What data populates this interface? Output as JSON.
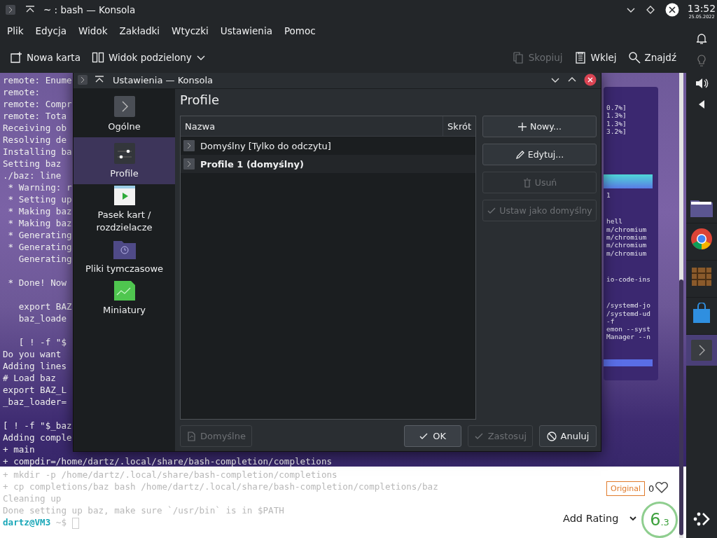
{
  "window": {
    "title": "~ : bash — Konsola"
  },
  "clock": {
    "time": "13:52",
    "date": "25.05.2022"
  },
  "menu": [
    "Plik",
    "Edycja",
    "Widok",
    "Zakładki",
    "Wtyczki",
    "Ustawienia",
    "Pomoc"
  ],
  "toolbar": [
    {
      "label": "Nowa karta",
      "kind": "new-tab",
      "disabled": false
    },
    {
      "label": "Widok podzielony",
      "kind": "split",
      "disabled": false
    },
    {
      "label": "Skopiuj",
      "kind": "copy",
      "disabled": true
    },
    {
      "label": "Wklej",
      "kind": "paste",
      "disabled": false
    },
    {
      "label": "Znajdź",
      "kind": "find",
      "disabled": false
    }
  ],
  "terminal": {
    "blocks": [
      [
        "remote: Enume",
        "remote:",
        "remote: Compr",
        "remote: Tota",
        "Receiving ob",
        "Resolving de",
        "Installing ba",
        "Setting baz",
        "./baz: line",
        " * Warning: r",
        " * Setting up",
        " * Making baz",
        " * Making baz",
        " * Generating",
        " * Generating",
        "   Generating"
      ],
      [
        " * Done! Now"
      ],
      [
        "   export BAZ",
        "   baz_loade"
      ],
      [
        "   [ ! -f \"$",
        "Do you want",
        "Adding lines",
        "# Load baz",
        "export BAZ_L",
        "_baz_loader="
      ],
      [
        "[ ! -f \"$_baz",
        "Adding comple",
        "+ main",
        "+ compdir=/home/dartz/.local/share/bash-completion/completions"
      ]
    ],
    "faded_lines": [
      "+ mkdir -p /home/dartz/.local/share/bash-completion/completions",
      "+ cp completions/baz bash /home/dartz/.local/share/bash-completion/completions/baz",
      "Cleaning up",
      "Done setting up baz, make sure `/usr/bin` is in $PATH"
    ],
    "prompt": {
      "user": "dartz@VM3",
      "path": "~$"
    }
  },
  "monitor": {
    "groups": [
      [
        "0.7%]",
        "1.3%]",
        "1.3%]",
        "3.2%]"
      ],
      [
        "1"
      ],
      [
        "hell",
        "m/chromium",
        "m/chromium",
        "m/chromium",
        "m/chromium"
      ],
      [
        "io-code-ins"
      ],
      [
        "/systemd-jo",
        "/systemd-ud",
        "-f",
        "emon --syst",
        "Manager --n"
      ]
    ]
  },
  "dialog": {
    "title": "Ustawienia — Konsola",
    "sidebar": [
      {
        "label": "Ogólne",
        "kind": "general",
        "selected": false
      },
      {
        "label": "Profile",
        "kind": "profiles",
        "selected": true
      },
      {
        "label": "Pasek kart / rozdzielacze",
        "kind": "tabbar",
        "selected": false
      },
      {
        "label": "Pliki tymczasowe",
        "kind": "temp",
        "selected": false
      },
      {
        "label": "Miniatury",
        "kind": "thumbs",
        "selected": false
      }
    ],
    "heading": "Profile",
    "table": {
      "columns": [
        "Nazwa",
        "Skrót"
      ],
      "rows": [
        {
          "name": "Domyślny [Tylko do odczytu]",
          "default": false
        },
        {
          "name": "Profile 1 (domyślny)",
          "default": true
        }
      ]
    },
    "actions": [
      {
        "label": "Nowy...",
        "kind": "add",
        "disabled": false
      },
      {
        "label": "Edytuj...",
        "kind": "edit",
        "disabled": false
      },
      {
        "label": "Usuń",
        "kind": "delete",
        "disabled": true
      },
      {
        "label": "Ustaw jako domyślny",
        "kind": "check",
        "disabled": true
      }
    ],
    "footer": [
      {
        "label": "Domyślne",
        "kind": "defaults",
        "disabled": true
      },
      {
        "label": "OK",
        "kind": "ok",
        "disabled": false
      },
      {
        "label": "Zastosuj",
        "kind": "apply",
        "disabled": true
      },
      {
        "label": "Anuluj",
        "kind": "cancel",
        "disabled": false
      }
    ]
  },
  "overlay": {
    "badge": "Original",
    "likes": "0",
    "rating_button": "Add Rating",
    "score": "6",
    "score_decimal": ".3"
  }
}
